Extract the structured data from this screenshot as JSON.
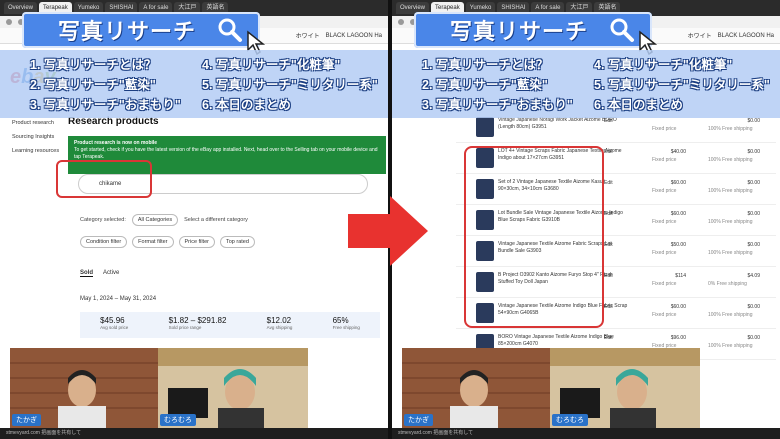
{
  "banner": {
    "title": "写真リサーチ"
  },
  "menu": {
    "items": [
      "1. 写真リサーチとは？",
      "4. 写真リサーチ\"化粧筆\"",
      "2. 写真リサーチ\"藍染\"",
      "5. 写真リサーチ\"ミリタリー系\"",
      "3. 写真リサーチ\"おまもり\"",
      "6. 本日のまとめ"
    ]
  },
  "browser": {
    "tabs": [
      "Overview",
      "Terapeak",
      "Yumeko",
      "SHISHAI",
      "A for sale",
      "大江戸",
      "英語名",
      "英語名"
    ],
    "bookmarks": [
      "ホワイト",
      "BLACK LAGOON Ha"
    ]
  },
  "left": {
    "ebay_letters": [
      "e",
      "b",
      "a",
      "y"
    ],
    "side_items": [
      "Product research",
      "Sourcing Insights",
      "Learning resources"
    ],
    "research_title": "Research products",
    "notice_title": "Product research is now on mobile",
    "notice_text": "To get started, check if you have the latest version of the eBay app installed. Next, head over to the Selling tab on your mobile device and tap Terapeak.",
    "search_value": "chikame",
    "category_label": "Category selected:",
    "category_value": "All Categories",
    "category_other": "Select a different category",
    "filters": [
      "Condition filter",
      "Format filter",
      "Price filter",
      "Top rated"
    ],
    "tab_sold": "Sold",
    "tab_active": "Active",
    "date_range": "May 1, 2024 – May 31, 2024",
    "stats": [
      {
        "v": "$45.96",
        "l": "Avg sold price"
      },
      {
        "v": "$1.82 – $291.82",
        "l": "Sold price range"
      },
      {
        "v": "$12.02",
        "l": "Avg shipping"
      },
      {
        "v": "65%",
        "l": "Free shipping"
      }
    ]
  },
  "right": {
    "rows": [
      {
        "desc": "Vintage Japanese Noragi Work Jacket Aizome BORO (Length 80cm) G3951",
        "edit": "Edit",
        "price": "",
        "plab": "Fixed price",
        "ship": "$0.00",
        "slab": "100% Free shipping"
      },
      {
        "desc": "LOT 4+ Vintage Scraps Fabric Japanese Textile Aizome Indigo about 17×27cm G3951",
        "edit": "Edit",
        "price": "$40.00",
        "plab": "Fixed price",
        "ship": "$0.00",
        "slab": "100% Free shipping"
      },
      {
        "desc": "Set of 2 Vintage Japanese Textile Aizome Kasuri 90×30cm, 34×10cm G3680",
        "edit": "Edit",
        "price": "$60.00",
        "plab": "Fixed price",
        "ship": "$0.00",
        "slab": "100% Free shipping"
      },
      {
        "desc": "Lot Bundle Sale Vintage Japanese Textile Aizome Indigo Blue Scraps Fabric G3910B",
        "edit": "Edit",
        "price": "$60.00",
        "plab": "Fixed price",
        "ship": "$0.00",
        "slab": "100% Free shipping"
      },
      {
        "desc": "Vintage Japanese Textile Aizome Fabric Scraps Lot Bundle Sale G3903",
        "edit": "Edit",
        "price": "$50.00",
        "plab": "Fixed price",
        "ship": "$0.00",
        "slab": "100% Free shipping"
      },
      {
        "desc": "B Project O3902 Kanto Aizome Furyo Stop 4\" Plush Stuffed Toy Doll Japan",
        "edit": "Edit",
        "price": "$114",
        "plab": "Fixed price",
        "ship": "$4.09",
        "slab": "0% Free shipping"
      },
      {
        "desc": "Vintage Japanese Textile Aizome Indigo Blue Fabric Scrap 54×90cm G4065B",
        "edit": "Edit",
        "price": "$60.00",
        "plab": "Fixed price",
        "ship": "$0.00",
        "slab": "100% Free shipping"
      },
      {
        "desc": "BORO Vintage Japanese Textile Aizome Indigo Blue 85×200cm G4070",
        "edit": "Edit",
        "price": "$96.00",
        "plab": "Fixed price",
        "ship": "$0.00",
        "slab": "100% Free shipping"
      }
    ]
  },
  "cams": {
    "left_a": "たかぎ",
    "left_b": "むろむろ",
    "right_a": "たかぎ",
    "right_b": "むろむろ"
  },
  "footer": {
    "text": "stmevyard.com 把画面を共有して"
  }
}
